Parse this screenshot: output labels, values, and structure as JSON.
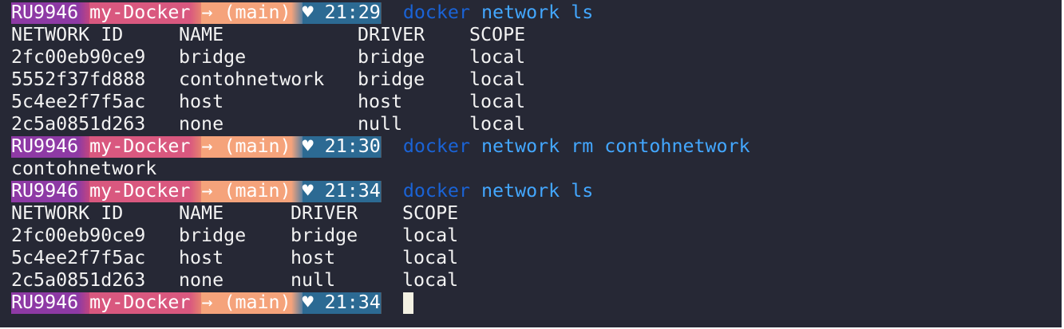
{
  "prompt": {
    "user": "RU9946",
    "dir": "my-Docker",
    "git": "→ (main)",
    "heart": "♥"
  },
  "blocks": [
    {
      "time": "21:29",
      "command": {
        "cmd": "docker",
        "args": "network ls"
      },
      "output_header": [
        "NETWORK ID",
        "NAME",
        "DRIVER",
        "SCOPE"
      ],
      "rows": [
        [
          "2fc00eb90ce9",
          "bridge",
          "bridge",
          "local"
        ],
        [
          "5552f37fd888",
          "contohnetwork",
          "bridge",
          "local"
        ],
        [
          "5c4ee2f7f5ac",
          "host",
          "host",
          "local"
        ],
        [
          "2c5a0851d263",
          "none",
          "null",
          "local"
        ]
      ]
    },
    {
      "time": "21:30",
      "command": {
        "cmd": "docker",
        "args": "network rm contohnetwork"
      },
      "output_text": "contohnetwork"
    },
    {
      "time": "21:34",
      "command": {
        "cmd": "docker",
        "args": "network ls"
      },
      "output_header": [
        "NETWORK ID",
        "NAME",
        "DRIVER",
        "SCOPE"
      ],
      "rows": [
        [
          "2fc00eb90ce9",
          "bridge",
          "bridge",
          "local"
        ],
        [
          "5c4ee2f7f5ac",
          "host",
          "host",
          "local"
        ],
        [
          "2c5a0851d263",
          "none",
          "null",
          "local"
        ]
      ]
    },
    {
      "time": "21:34"
    }
  ],
  "colors": {
    "background": "#262835",
    "user_segment": "#8e3aa5",
    "dir_segment": "#d9587f",
    "git_segment": "#f5a37b",
    "time_segment": "#2c6a93",
    "command": "#1a63d6",
    "args": "#43a7ff",
    "text": "#f2f2f2"
  }
}
